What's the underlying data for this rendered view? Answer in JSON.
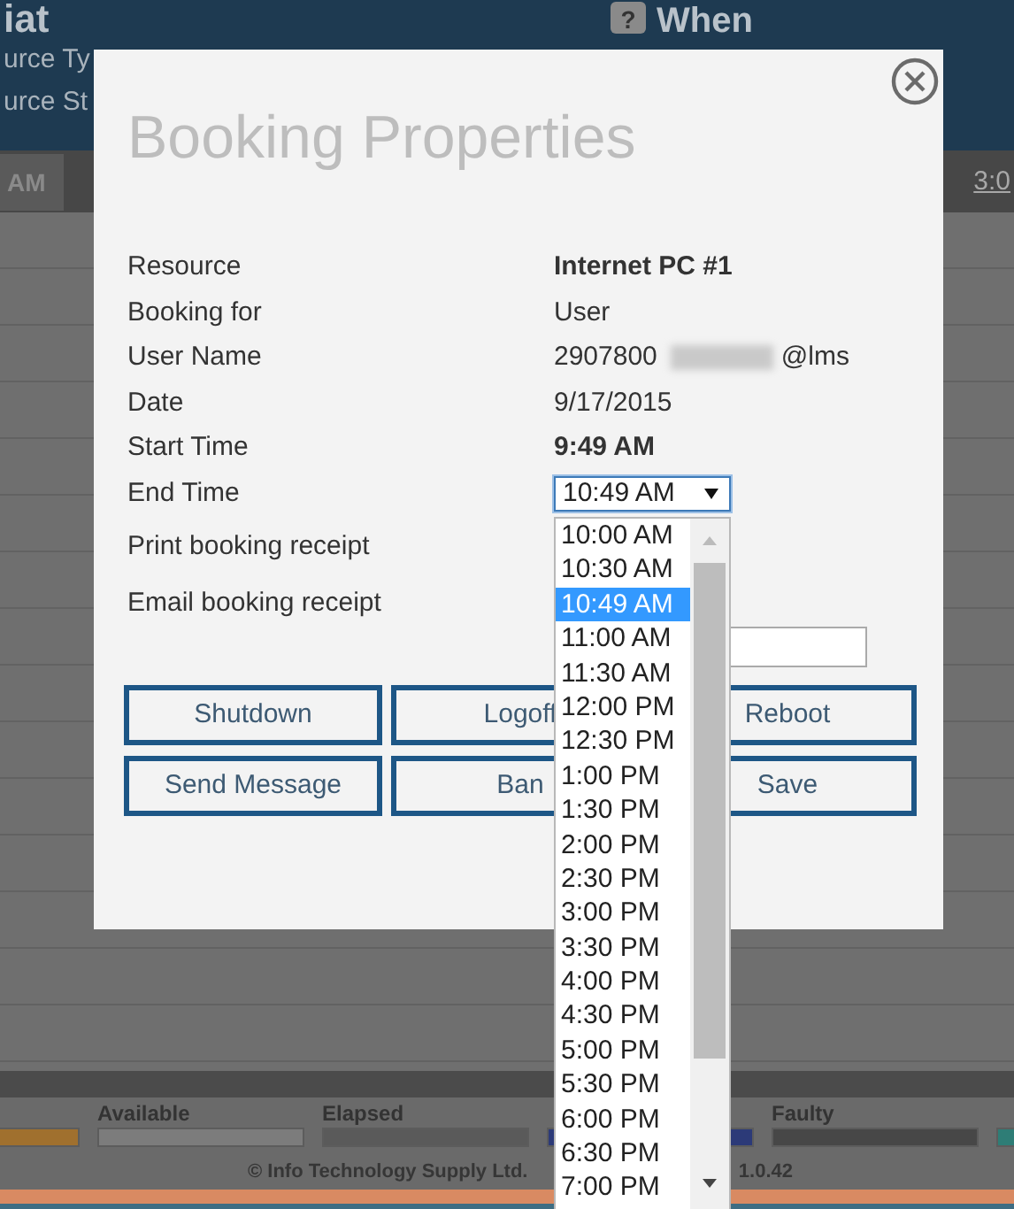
{
  "background": {
    "header": {
      "title": "iat",
      "fields": [
        "urce Ty",
        "urce St"
      ],
      "help_icon": "?",
      "when_title": "When"
    },
    "timeline": {
      "left_label": "AM",
      "right_label": "3:0"
    },
    "legend": [
      {
        "color": "#a0702e"
      },
      {
        "label": "Available",
        "color": "#7c7c7c"
      },
      {
        "label": "Elapsed",
        "color": "#5a5a5a"
      },
      {
        "color": "#2c3a78"
      },
      {
        "label": "Faulty",
        "color": "#474747"
      },
      {
        "color": "#2e7d76"
      }
    ],
    "footer": {
      "copyright": "© Info Technology Supply Ltd.",
      "version": "1.0.42"
    }
  },
  "dialog": {
    "title": "Booking Properties",
    "rows": [
      {
        "kind": "text",
        "label": "Resource",
        "value": "Internet PC #1",
        "bold": true
      },
      {
        "kind": "text",
        "label": "Booking for",
        "value": "User",
        "bold": false
      },
      {
        "kind": "text",
        "label": "User Name",
        "value": "2907800",
        "redacted": true,
        "value_suffix": "@lms",
        "bold": false
      },
      {
        "kind": "text",
        "label": "Date",
        "value": "9/17/2015",
        "bold": false
      },
      {
        "kind": "text",
        "label": "Start Time",
        "value": "9:49 AM",
        "bold": true
      },
      {
        "kind": "select",
        "label": "End Time",
        "value": "10:49 AM",
        "expanded": true,
        "options": [
          {
            "label": "10:00 AM",
            "selected": false
          },
          {
            "label": "10:30 AM",
            "selected": false
          },
          {
            "label": "10:49 AM",
            "selected": true
          },
          {
            "label": "11:00 AM",
            "selected": false
          },
          {
            "label": "11:30 AM",
            "selected": false
          },
          {
            "label": "12:00 PM",
            "selected": false
          },
          {
            "label": "12:30 PM",
            "selected": false
          },
          {
            "label": "1:00 PM",
            "selected": false
          },
          {
            "label": "1:30 PM",
            "selected": false
          },
          {
            "label": "2:00 PM",
            "selected": false
          },
          {
            "label": "2:30 PM",
            "selected": false
          },
          {
            "label": "3:00 PM",
            "selected": false
          },
          {
            "label": "3:30 PM",
            "selected": false
          },
          {
            "label": "4:00 PM",
            "selected": false
          },
          {
            "label": "4:30 PM",
            "selected": false
          },
          {
            "label": "5:00 PM",
            "selected": false
          },
          {
            "label": "5:30 PM",
            "selected": false
          },
          {
            "label": "6:00 PM",
            "selected": false
          },
          {
            "label": "6:30 PM",
            "selected": false
          },
          {
            "label": "7:00 PM",
            "selected": false
          }
        ]
      },
      {
        "kind": "label",
        "label": "Print booking receipt"
      },
      {
        "kind": "input",
        "label": "Email booking receipt"
      }
    ],
    "buttons": [
      "Shutdown",
      "Logoff",
      "Reboot",
      "Send Message",
      "Ban",
      "Save"
    ]
  }
}
